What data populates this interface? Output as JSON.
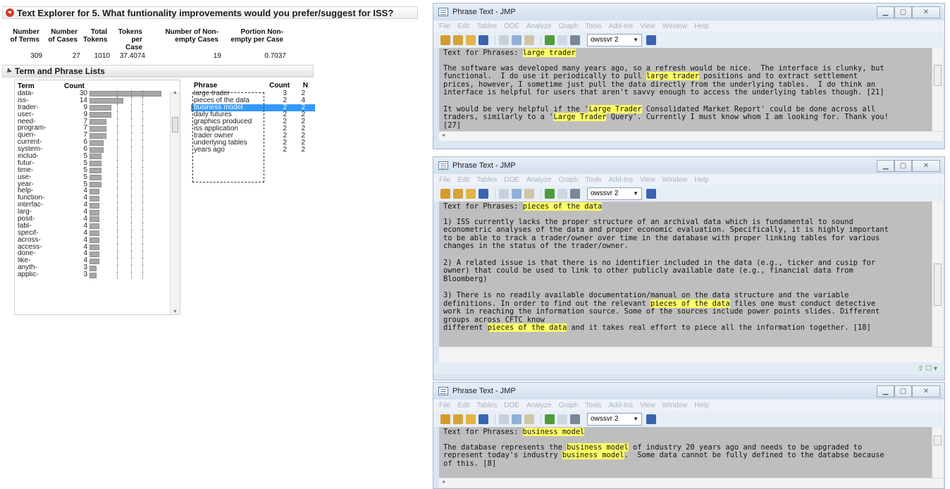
{
  "report": {
    "title": "Text Explorer for 5. What funtionality improvements would you prefer/suggest for ISS?",
    "summary": {
      "headers": [
        [
          "Number",
          "of Terms"
        ],
        [
          "Number",
          "of Cases"
        ],
        [
          "Total",
          "Tokens"
        ],
        [
          "Tokens",
          "per Case"
        ],
        [
          "Number of Non-",
          "empty Cases"
        ],
        [
          "Portion Non-",
          "empty per Case"
        ]
      ],
      "values": [
        "309",
        "27",
        "1010",
        "37.4074",
        "19",
        "0.7037"
      ]
    },
    "lists_title": "Term and Phrase Lists",
    "term_table": {
      "col_term": "Term",
      "col_count": "Count",
      "rows": [
        {
          "term": "data-",
          "count": 30
        },
        {
          "term": "iss-",
          "count": 14
        },
        {
          "term": "trader-",
          "count": 9
        },
        {
          "term": "user-",
          "count": 9
        },
        {
          "term": "need-",
          "count": 7
        },
        {
          "term": "program-",
          "count": 7
        },
        {
          "term": "queri-",
          "count": 7
        },
        {
          "term": "current-",
          "count": 6
        },
        {
          "term": "system-",
          "count": 6
        },
        {
          "term": "includ-",
          "count": 5
        },
        {
          "term": "futur-",
          "count": 5
        },
        {
          "term": "time-",
          "count": 5
        },
        {
          "term": "use-",
          "count": 5
        },
        {
          "term": "year-",
          "count": 5
        },
        {
          "term": "help-",
          "count": 4
        },
        {
          "term": "function-",
          "count": 4
        },
        {
          "term": "interfac-",
          "count": 4
        },
        {
          "term": "larg-",
          "count": 4
        },
        {
          "term": "posit-",
          "count": 4
        },
        {
          "term": "tabl-",
          "count": 4
        },
        {
          "term": "specif-",
          "count": 4
        },
        {
          "term": "across-",
          "count": 4
        },
        {
          "term": "access-",
          "count": 4
        },
        {
          "term": "done-",
          "count": 4
        },
        {
          "term": "like-",
          "count": 4
        },
        {
          "term": "anyth-",
          "count": 3
        },
        {
          "term": "applic-",
          "count": 3
        }
      ]
    },
    "phrase_table": {
      "col_phrase": "Phrase",
      "col_count": "Count",
      "col_n": "N",
      "rows": [
        {
          "phrase": "large trader",
          "count": "3",
          "n": "2"
        },
        {
          "phrase": "pieces of the data",
          "count": "2",
          "n": "4"
        },
        {
          "phrase": "business model",
          "count": "2",
          "n": "2",
          "selected": true
        },
        {
          "phrase": "daily futures",
          "count": "2",
          "n": "2"
        },
        {
          "phrase": "graphics produced",
          "count": "2",
          "n": "2"
        },
        {
          "phrase": "iss application",
          "count": "2",
          "n": "2"
        },
        {
          "phrase": "trader owner",
          "count": "2",
          "n": "2"
        },
        {
          "phrase": "underlying tables",
          "count": "2",
          "n": "2"
        },
        {
          "phrase": "years ago",
          "count": "2",
          "n": "2"
        }
      ]
    }
  },
  "windows": {
    "title": "Phrase Text - JMP",
    "menu": [
      "File",
      "Edit",
      "Tables",
      "DOE",
      "Analyze",
      "Graph",
      "Tools",
      "Add-Ins",
      "View",
      "Window",
      "Help"
    ],
    "server": "owssvr 2",
    "w1": {
      "label": "Text for Phrases:",
      "phrase": "large trader",
      "para1": [
        {
          "t": "The software was developed many years ago, so a refresh would be nice.  The interface is clunky, but\nfunctional.  I do use it periodically to pull "
        },
        {
          "t": "large trader",
          "h": true
        },
        {
          "t": " positions and to extract settlement\nprices, however, I sometime just pull the data directly from the underlying tables.  I do think an\ninterface is helpful for users that aren't savvy enough to access the underlying tables though. [21]"
        }
      ],
      "para2": [
        {
          "t": "It would be very helpful if the '"
        },
        {
          "t": "Large Trader",
          "h": true
        },
        {
          "t": " Consolidated Market Report' could be done across all\ntraders, similarly to a '"
        },
        {
          "t": "Large Trader",
          "h": true
        },
        {
          "t": " Query'. Currently I must know whom I am looking for. Thank you!\n[27]"
        }
      ]
    },
    "w2": {
      "label": "Text for Phrases:",
      "phrase": "pieces of the data",
      "para1": [
        {
          "t": "1) ISS currently lacks the proper structure of an archival data which is fundamental to sound\neconometric analyses of the data and proper economic evaluation. Specifically, it is highly important\nto be able to track a trader/owner over time in the database with proper linking tables for various\nchanges in the status of the trader/owner."
        }
      ],
      "para2": [
        {
          "t": "2) A related issue is that there is no identifier included in the data (e.g., ticker and cusip for\nowner) that could be used to link to other publicly available date (e.g., financial data from\nBloomberg)"
        }
      ],
      "para3": [
        {
          "t": "3) There is no readily available documentation/manual on the data structure and the variable\ndefinitions. In order to find out the relevant "
        },
        {
          "t": "pieces of the data",
          "h": true
        },
        {
          "t": " files one must conduct detective\nwork in reaching the information source. Some of the sources include power points slides. Different\ngroups across CFTC know\ndifferent "
        },
        {
          "t": "pieces of the data",
          "h": true
        },
        {
          "t": " and it takes real effort to piece all the information together. [18]"
        }
      ]
    },
    "w3": {
      "label": "Text for Phrases:",
      "phrase": "business model",
      "para1": [
        {
          "t": "The database represents the "
        },
        {
          "t": "business model",
          "h": true
        },
        {
          "t": " of industry 20 years ago and needs to be upgraded to\nrepresent today's industry "
        },
        {
          "t": "business model",
          "h": true
        },
        {
          "t": ".  Some data cannot be fully defined to the databse because\nof this. [8]"
        }
      ]
    },
    "colors": {
      "highlight": "#ffff66",
      "selected_row": "#3399ff",
      "text_bg": "#bebebe"
    }
  }
}
